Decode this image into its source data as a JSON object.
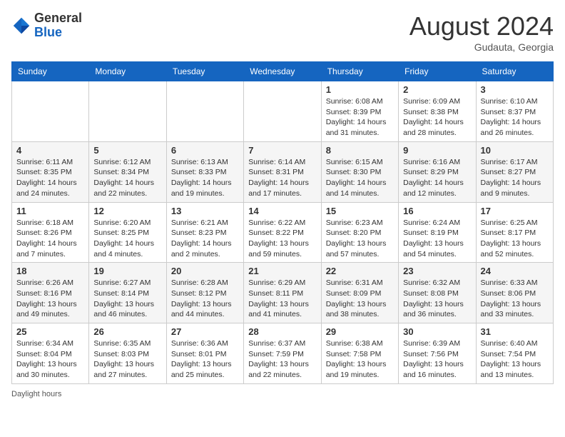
{
  "header": {
    "logo_general": "General",
    "logo_blue": "Blue",
    "title": "August 2024",
    "location": "Gudauta, Georgia"
  },
  "calendar": {
    "days_of_week": [
      "Sunday",
      "Monday",
      "Tuesday",
      "Wednesday",
      "Thursday",
      "Friday",
      "Saturday"
    ],
    "weeks": [
      [
        {
          "day": "",
          "info": ""
        },
        {
          "day": "",
          "info": ""
        },
        {
          "day": "",
          "info": ""
        },
        {
          "day": "",
          "info": ""
        },
        {
          "day": "1",
          "info": "Sunrise: 6:08 AM\nSunset: 8:39 PM\nDaylight: 14 hours and 31 minutes."
        },
        {
          "day": "2",
          "info": "Sunrise: 6:09 AM\nSunset: 8:38 PM\nDaylight: 14 hours and 28 minutes."
        },
        {
          "day": "3",
          "info": "Sunrise: 6:10 AM\nSunset: 8:37 PM\nDaylight: 14 hours and 26 minutes."
        }
      ],
      [
        {
          "day": "4",
          "info": "Sunrise: 6:11 AM\nSunset: 8:35 PM\nDaylight: 14 hours and 24 minutes."
        },
        {
          "day": "5",
          "info": "Sunrise: 6:12 AM\nSunset: 8:34 PM\nDaylight: 14 hours and 22 minutes."
        },
        {
          "day": "6",
          "info": "Sunrise: 6:13 AM\nSunset: 8:33 PM\nDaylight: 14 hours and 19 minutes."
        },
        {
          "day": "7",
          "info": "Sunrise: 6:14 AM\nSunset: 8:31 PM\nDaylight: 14 hours and 17 minutes."
        },
        {
          "day": "8",
          "info": "Sunrise: 6:15 AM\nSunset: 8:30 PM\nDaylight: 14 hours and 14 minutes."
        },
        {
          "day": "9",
          "info": "Sunrise: 6:16 AM\nSunset: 8:29 PM\nDaylight: 14 hours and 12 minutes."
        },
        {
          "day": "10",
          "info": "Sunrise: 6:17 AM\nSunset: 8:27 PM\nDaylight: 14 hours and 9 minutes."
        }
      ],
      [
        {
          "day": "11",
          "info": "Sunrise: 6:18 AM\nSunset: 8:26 PM\nDaylight: 14 hours and 7 minutes."
        },
        {
          "day": "12",
          "info": "Sunrise: 6:20 AM\nSunset: 8:25 PM\nDaylight: 14 hours and 4 minutes."
        },
        {
          "day": "13",
          "info": "Sunrise: 6:21 AM\nSunset: 8:23 PM\nDaylight: 14 hours and 2 minutes."
        },
        {
          "day": "14",
          "info": "Sunrise: 6:22 AM\nSunset: 8:22 PM\nDaylight: 13 hours and 59 minutes."
        },
        {
          "day": "15",
          "info": "Sunrise: 6:23 AM\nSunset: 8:20 PM\nDaylight: 13 hours and 57 minutes."
        },
        {
          "day": "16",
          "info": "Sunrise: 6:24 AM\nSunset: 8:19 PM\nDaylight: 13 hours and 54 minutes."
        },
        {
          "day": "17",
          "info": "Sunrise: 6:25 AM\nSunset: 8:17 PM\nDaylight: 13 hours and 52 minutes."
        }
      ],
      [
        {
          "day": "18",
          "info": "Sunrise: 6:26 AM\nSunset: 8:16 PM\nDaylight: 13 hours and 49 minutes."
        },
        {
          "day": "19",
          "info": "Sunrise: 6:27 AM\nSunset: 8:14 PM\nDaylight: 13 hours and 46 minutes."
        },
        {
          "day": "20",
          "info": "Sunrise: 6:28 AM\nSunset: 8:12 PM\nDaylight: 13 hours and 44 minutes."
        },
        {
          "day": "21",
          "info": "Sunrise: 6:29 AM\nSunset: 8:11 PM\nDaylight: 13 hours and 41 minutes."
        },
        {
          "day": "22",
          "info": "Sunrise: 6:31 AM\nSunset: 8:09 PM\nDaylight: 13 hours and 38 minutes."
        },
        {
          "day": "23",
          "info": "Sunrise: 6:32 AM\nSunset: 8:08 PM\nDaylight: 13 hours and 36 minutes."
        },
        {
          "day": "24",
          "info": "Sunrise: 6:33 AM\nSunset: 8:06 PM\nDaylight: 13 hours and 33 minutes."
        }
      ],
      [
        {
          "day": "25",
          "info": "Sunrise: 6:34 AM\nSunset: 8:04 PM\nDaylight: 13 hours and 30 minutes."
        },
        {
          "day": "26",
          "info": "Sunrise: 6:35 AM\nSunset: 8:03 PM\nDaylight: 13 hours and 27 minutes."
        },
        {
          "day": "27",
          "info": "Sunrise: 6:36 AM\nSunset: 8:01 PM\nDaylight: 13 hours and 25 minutes."
        },
        {
          "day": "28",
          "info": "Sunrise: 6:37 AM\nSunset: 7:59 PM\nDaylight: 13 hours and 22 minutes."
        },
        {
          "day": "29",
          "info": "Sunrise: 6:38 AM\nSunset: 7:58 PM\nDaylight: 13 hours and 19 minutes."
        },
        {
          "day": "30",
          "info": "Sunrise: 6:39 AM\nSunset: 7:56 PM\nDaylight: 13 hours and 16 minutes."
        },
        {
          "day": "31",
          "info": "Sunrise: 6:40 AM\nSunset: 7:54 PM\nDaylight: 13 hours and 13 minutes."
        }
      ]
    ]
  },
  "footer": {
    "daylight_label": "Daylight hours"
  }
}
